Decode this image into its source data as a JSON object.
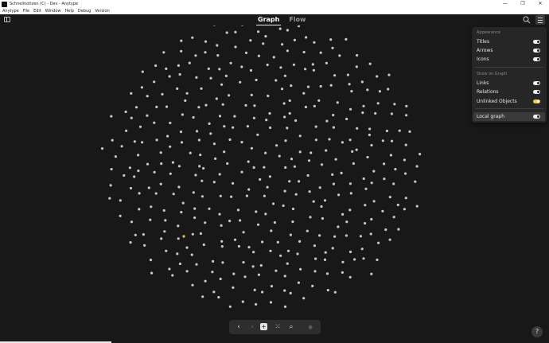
{
  "window": {
    "title": "Schnellnotizen (C) - Dev - Anytype",
    "controls": [
      "—",
      "❐",
      "✕"
    ]
  },
  "menu": [
    "Anytype",
    "File",
    "Edit",
    "Window",
    "Help",
    "Debug",
    "Version"
  ],
  "header": {
    "tabs": [
      "Graph",
      "Flow"
    ]
  },
  "settings_panel": {
    "appearance_title": "Appearance",
    "appearance_items": [
      {
        "label": "Titles",
        "on": false
      },
      {
        "label": "Arrows",
        "on": false
      },
      {
        "label": "Icons",
        "on": false
      }
    ],
    "show_title": "Show on Graph",
    "show_items": [
      {
        "label": "Links",
        "on": false
      },
      {
        "label": "Relations",
        "on": false
      },
      {
        "label": "Unlinked Objects",
        "on": true
      }
    ],
    "local_graph": {
      "label": "Local graph",
      "on": false
    }
  },
  "bottom_nav": {
    "back": "‹",
    "forward": "›",
    "add": "+",
    "graph": "⁙",
    "search": "⌕",
    "record": "◉"
  },
  "help": "?",
  "colors": {
    "node": "#c8c8c8",
    "highlight_node": "#f0c84a",
    "background": "#181818"
  },
  "graph": {
    "node_count": 420,
    "highlighted_node_index": 12
  }
}
